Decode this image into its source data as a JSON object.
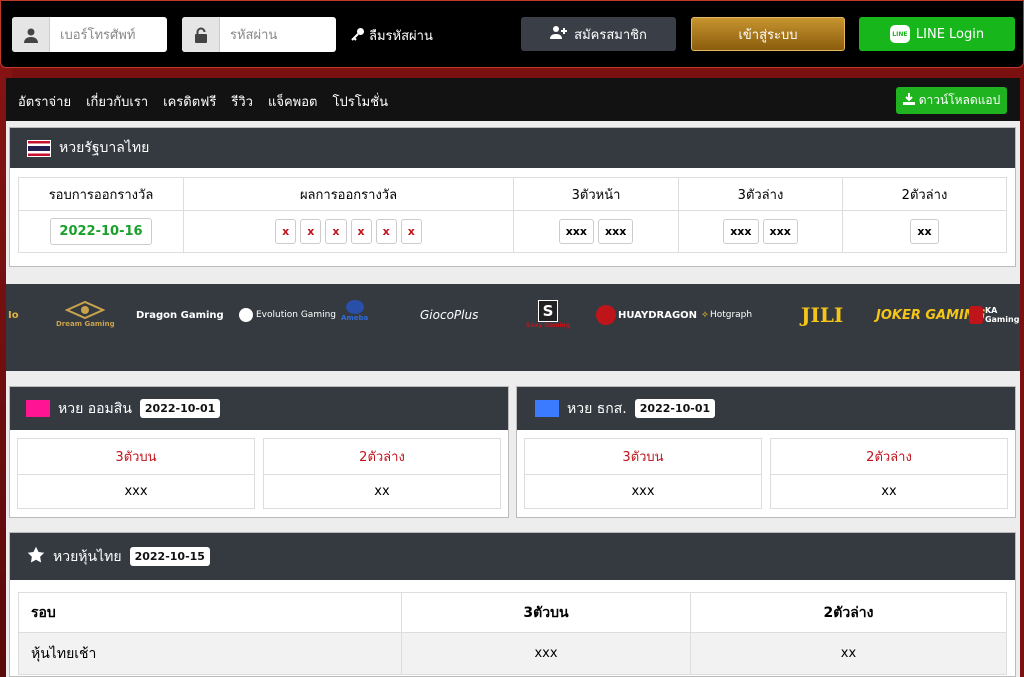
{
  "login": {
    "phone_placeholder": "เบอร์โทรศัพท์",
    "password_placeholder": "รหัสผ่าน",
    "forgot_label": "ลืมรหัสผ่าน",
    "register_label": "สมัครสมาชิก",
    "login_label": "เข้าสู่ระบบ",
    "line_label": "LINE Login",
    "line_badge": "LINE"
  },
  "menu": {
    "items": [
      "อัตราจ่าย",
      "เกี่ยวกับเรา",
      "เครดิตฟรี",
      "รีวิว",
      "แจ็คพอต",
      "โปรโมชั่น"
    ],
    "download_label": "ดาวน์โหลดแอป"
  },
  "thai_gov": {
    "title": "หวยรัฐบาลไทย",
    "headers": [
      "รอบการออกรางวัล",
      "ผลการออกรางวัล",
      "3ตัวหน้า",
      "3ตัวล่าง",
      "2ตัวล่าง"
    ],
    "date": "2022-10-16",
    "results": [
      "x",
      "x",
      "x",
      "x",
      "x",
      "x"
    ],
    "front3": [
      "xxx",
      "xxx"
    ],
    "back3": [
      "xxx",
      "xxx"
    ],
    "back2": "xx"
  },
  "providers": [
    "Dream Gaming",
    "Dragon Gaming",
    "Evolution Gaming",
    "Ameba",
    "GiocoPlus",
    "Sexy Gaming",
    "HUAYDRAGON",
    "Hotgraph",
    "JILI",
    "JOKER GAMING",
    "KA Gaming"
  ],
  "gsb": {
    "title": "หวย ออมสิน",
    "date": "2022-10-01",
    "col1": "3ตัวบน",
    "col2": "2ตัวล่าง",
    "val1": "xxx",
    "val2": "xx",
    "color": "#ff1493"
  },
  "baac": {
    "title": "หวย ธกส.",
    "date": "2022-10-01",
    "col1": "3ตัวบน",
    "col2": "2ตัวล่าง",
    "val1": "xxx",
    "val2": "xx",
    "color": "#3b7bff"
  },
  "stock": {
    "title": "หวยหุ้นไทย",
    "date": "2022-10-15",
    "headers": [
      "รอบ",
      "3ตัวบน",
      "2ตัวล่าง"
    ],
    "row_label": "หุ้นไทยเช้า",
    "row_val1": "xxx",
    "row_val2": "xx"
  }
}
